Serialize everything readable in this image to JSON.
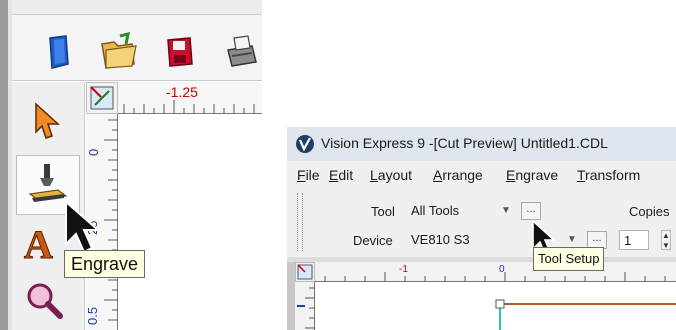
{
  "left_view": {
    "toolbar_icons": [
      "new-document-icon",
      "open-folder-icon",
      "save-icon",
      "print-icon"
    ],
    "tools": [
      "select-arrow-icon",
      "engrave-icon",
      "text-icon",
      "zoom-icon"
    ],
    "ruler": {
      "horizontal_label": "-1.25",
      "vertical_labels": [
        "0",
        "25",
        "0.5"
      ]
    },
    "tooltip": "Engrave"
  },
  "right_view": {
    "title": "Vision Express 9 -[Cut Preview] Untitled1.CDL",
    "menu": [
      {
        "key": "F",
        "rest": "ile"
      },
      {
        "key": "E",
        "rest": "dit"
      },
      {
        "key": "L",
        "rest": "ayout"
      },
      {
        "key": "A",
        "rest": "rrange"
      },
      {
        "key": "E",
        "rest": "ngrave"
      },
      {
        "key": "T",
        "rest": "ransform"
      }
    ],
    "properties": {
      "tool_label": "Tool",
      "tool_value": "All Tools",
      "tool_button": "...",
      "copies_label": "Copies",
      "device_label": "Device",
      "device_value": "VE810 S3",
      "device_button": "...",
      "copies_value": "1"
    },
    "tooltip": "Tool Setup",
    "ruler": {
      "horizontal_labels": [
        "-1",
        "0"
      ]
    }
  }
}
